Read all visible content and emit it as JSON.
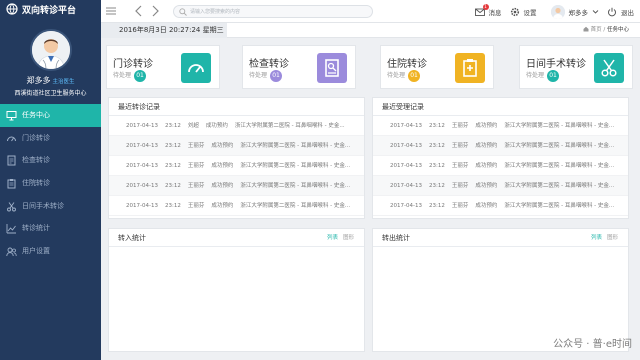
{
  "app": {
    "title": "双向转诊平台"
  },
  "user": {
    "name": "郑多多",
    "role": "主治医生",
    "org": "西溪街道社区卫生服务中心"
  },
  "menu": [
    {
      "label": "任务中心",
      "icon": "monitor-icon",
      "active": true
    },
    {
      "label": "门诊转诊",
      "icon": "gauge-icon",
      "active": false
    },
    {
      "label": "检查转诊",
      "icon": "document-icon",
      "active": false
    },
    {
      "label": "住院转诊",
      "icon": "clipboard-icon",
      "active": false
    },
    {
      "label": "日间手术转诊",
      "icon": "scissors-icon",
      "active": false
    },
    {
      "label": "转诊统计",
      "icon": "chart-icon",
      "active": false
    },
    {
      "label": "用户设置",
      "icon": "users-icon",
      "active": false
    }
  ],
  "topbar": {
    "search_placeholder": "请输入您要搜索的内容",
    "messages_label": "消息",
    "messages_count": "1",
    "settings_label": "设置",
    "user_name": "郑多多",
    "logout_label": "退出"
  },
  "datebar": {
    "datetime": "2016年8月3日  20:27:24  星期三",
    "crumb_home": "首页",
    "crumb_sep": "/",
    "crumb_current": "任务中心"
  },
  "cards": [
    {
      "title": "门诊转诊",
      "sub": "待处理",
      "count": "01",
      "color": "#1fb5a9",
      "icon": "gauge-icon"
    },
    {
      "title": "检查转诊",
      "sub": "待处理",
      "count": "01",
      "color": "#9b8bdc",
      "icon": "document-icon"
    },
    {
      "title": "住院转诊",
      "sub": "待处理",
      "count": "01",
      "color": "#f0b323",
      "icon": "clipboard-icon"
    },
    {
      "title": "日间手术转诊",
      "sub": "待处理",
      "count": "01",
      "color": "#1fb5a9",
      "icon": "scissors-icon"
    }
  ],
  "recent_referrals": {
    "title": "最近转诊记录",
    "rows": [
      {
        "date": "2017-04-13",
        "time": "23:12",
        "name": "刘超",
        "status": "成功预约",
        "detail": "浙江大学附属第二医院 - 耳鼻咽喉科 - 史金..."
      },
      {
        "date": "2017-04-13",
        "time": "23:12",
        "name": "王丽芬",
        "status": "成功预约",
        "detail": "浙江大学附属第二医院 - 耳鼻咽喉科 - 史金..."
      },
      {
        "date": "2017-04-13",
        "time": "23:12",
        "name": "王丽芬",
        "status": "成功预约",
        "detail": "浙江大学附属第二医院 - 耳鼻咽喉科 - 史金..."
      },
      {
        "date": "2017-04-13",
        "time": "23:12",
        "name": "王丽芬",
        "status": "成功预约",
        "detail": "浙江大学附属第二医院 - 耳鼻咽喉科 - 史金..."
      },
      {
        "date": "2017-04-13",
        "time": "23:12",
        "name": "王丽芬",
        "status": "成功预约",
        "detail": "浙江大学附属第二医院 - 耳鼻咽喉科 - 史金..."
      }
    ]
  },
  "recent_received": {
    "title": "最近受理记录",
    "rows": [
      {
        "date": "2017-04-13",
        "time": "23:12",
        "name": "王丽芬",
        "status": "成功预约",
        "detail": "浙江大学附属第二医院 - 耳鼻咽喉科 - 史金..."
      },
      {
        "date": "2017-04-13",
        "time": "23:12",
        "name": "王丽芬",
        "status": "成功预约",
        "detail": "浙江大学附属第二医院 - 耳鼻咽喉科 - 史金..."
      },
      {
        "date": "2017-04-13",
        "time": "23:12",
        "name": "王丽芬",
        "status": "成功预约",
        "detail": "浙江大学附属第二医院 - 耳鼻咽喉科 - 史金..."
      },
      {
        "date": "2017-04-13",
        "time": "23:12",
        "name": "王丽芬",
        "status": "成功预约",
        "detail": "浙江大学附属第二医院 - 耳鼻咽喉科 - 史金..."
      },
      {
        "date": "2017-04-13",
        "time": "23:12",
        "name": "王丽芬",
        "status": "成功预约",
        "detail": "浙江大学附属第二医院 - 耳鼻咽喉科 - 史金..."
      }
    ]
  },
  "stats_in": {
    "title": "转入统计",
    "tab_list": "列表",
    "tab_chart": "图形"
  },
  "stats_out": {
    "title": "转出统计",
    "tab_list": "列表",
    "tab_chart": "图形"
  },
  "watermark": "公众号 · 普·e时间"
}
